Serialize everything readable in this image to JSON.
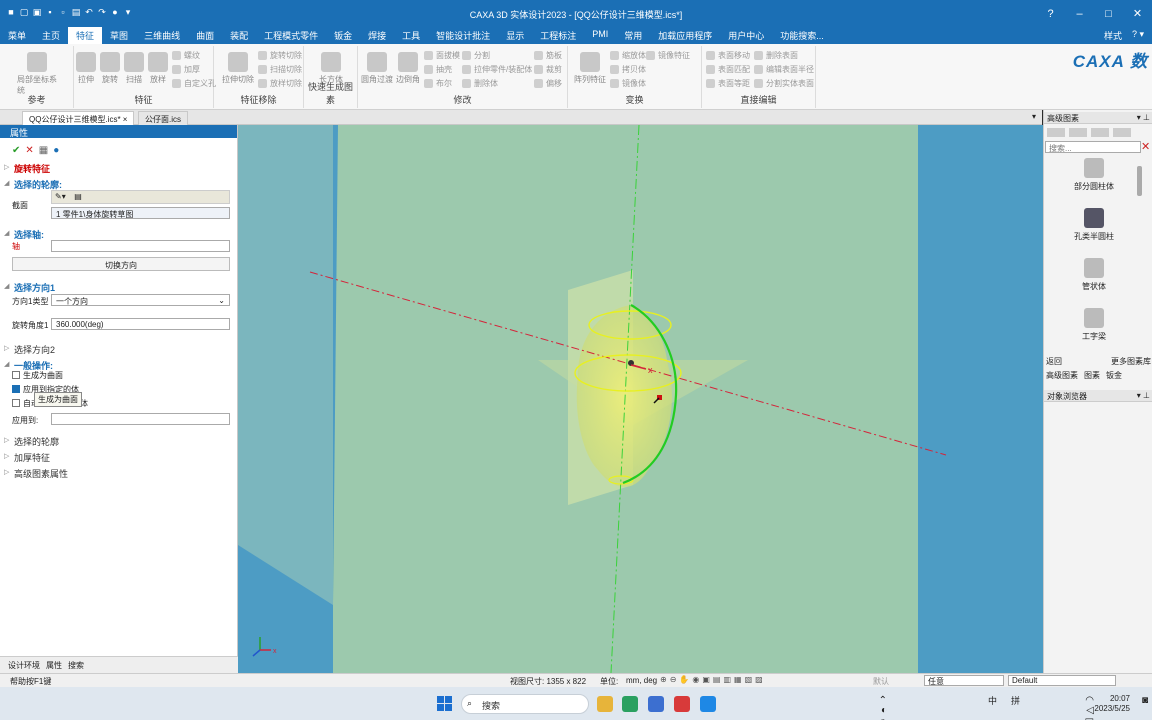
{
  "window": {
    "title": "CAXA 3D 实体设计2023 - [QQ公仔设计三维模型.ics*]"
  },
  "menu": {
    "items": [
      "菜单",
      "主页",
      "特征",
      "草图",
      "三维曲线",
      "曲面",
      "装配",
      "工程模式零件",
      "钣金",
      "焊接",
      "工具",
      "智能设计批注",
      "显示",
      "工程标注",
      "PMI",
      "常用",
      "加载应用程序",
      "用户中心",
      "功能搜索..."
    ],
    "active_index": 2,
    "style_label": "样式"
  },
  "ribbon": {
    "groups": [
      {
        "label": "参考",
        "buttons": [
          "局部坐标系统"
        ]
      },
      {
        "label": "特征",
        "buttons": [
          "拉伸",
          "旋转",
          "扫描",
          "放样"
        ],
        "small": [
          "螺纹",
          "加厚",
          "自定义孔"
        ]
      },
      {
        "label": "特征移除",
        "buttons": [
          "拉伸切除"
        ],
        "small": [
          "旋转切除",
          "扫描切除",
          "放样切除"
        ]
      },
      {
        "label": "快速生成图素",
        "buttons": [
          "长方体"
        ]
      },
      {
        "label": "修改",
        "buttons": [
          "圆角过渡",
          "边倒角"
        ],
        "small": [
          "面拔模",
          "抽壳",
          "布尔",
          "分割",
          "拉伸零件/装配体",
          "删除体",
          "筋板",
          "裁剪",
          "偏移"
        ]
      },
      {
        "label": "变换",
        "buttons": [
          "阵列特征"
        ],
        "small": [
          "缩放体",
          "拷贝体",
          "镜像体",
          "镜像特征"
        ]
      },
      {
        "label": "直接编辑",
        "small": [
          "表面移动",
          "表面匹配",
          "表面等距",
          "删除表面",
          "编辑表面半径",
          "分割实体表面"
        ]
      }
    ],
    "logo": "CAXA 数"
  },
  "doc_tabs": [
    "QQ公仔设计三维模型.ics*",
    "公仔面.ics"
  ],
  "left_panel": {
    "title": "属性",
    "feature_title": "旋转特征",
    "sec_profile": "选择的轮廓:",
    "section_label": "截面",
    "profile_item": "1   零件1\\身体旋转草图",
    "sec_axis": "选择轴:",
    "axis_label": "轴",
    "switch_dir": "切换方向",
    "sec_dir1": "选择方向1",
    "dir_type_label": "方向1类型",
    "dir_type_value": "一个方向",
    "angle_label": "旋转角度1",
    "angle_value": "360.000(deg)",
    "sec_dir2": "选择方向2",
    "sec_general": "一般操作:",
    "opt1": "生成为曲面",
    "opt2": "应用到指定的体",
    "opt3": "自动",
    "opt3_tail": "体",
    "tooltip": "生成为曲面",
    "apply_to": "应用到:",
    "sec_selected": "选择的轮廓",
    "sec_thicken": "加厚特征",
    "sec_adv": "高级图素属性",
    "bottom_tabs": [
      "设计环境",
      "属性",
      "搜索"
    ]
  },
  "right_panel": {
    "title": "高级图素",
    "search_placeholder": "搜索...",
    "items": [
      "部分圆柱体",
      "孔类半圆柱",
      "管状体",
      "工字梁"
    ],
    "back": "返回",
    "more": "更多图素库",
    "tabs": [
      "高级图素",
      "图素",
      "钣金"
    ],
    "browser_title": "对象浏览器"
  },
  "status": {
    "help": "帮助按F1键",
    "view_size": "视图尺寸: 1355 x  822",
    "units": "单位:",
    "units_value": "mm, deg",
    "mode": "默认",
    "filter": "任意",
    "scheme": "Default"
  },
  "taskbar": {
    "search": "搜索",
    "ime": "中",
    "ime2": "拼",
    "time": "20:07",
    "date": "2023/5/25"
  },
  "colors": {
    "accent": "#1b6fb5",
    "viewport": "#4d9cc4",
    "curve": "#22cc22",
    "ellipse": "#e8f020",
    "axis": "#d4243a"
  }
}
